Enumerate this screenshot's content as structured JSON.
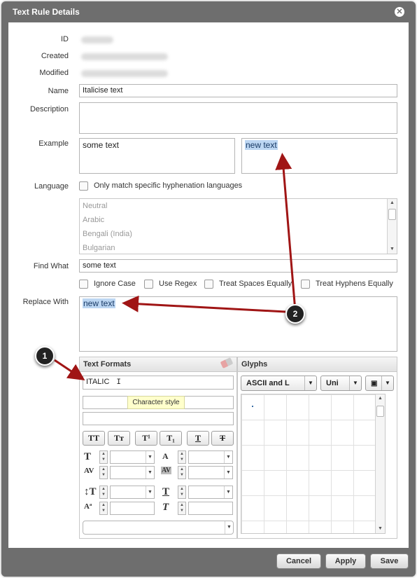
{
  "dialog": {
    "title": "Text Rule Details"
  },
  "fields": {
    "id_label": "ID",
    "created_label": "Created",
    "modified_label": "Modified",
    "name_label": "Name",
    "name_value": "Italicise text",
    "description_label": "Description",
    "example_label": "Example",
    "example_find": "some text",
    "example_replace": "new text",
    "language_label": "Language",
    "language_checkbox": "Only match specific hyphenation languages",
    "languages": [
      "Neutral",
      "Arabic",
      "Bengali (India)",
      "Bulgarian"
    ],
    "find_label": "Find What",
    "find_value": "some text",
    "options": [
      "Ignore Case",
      "Use Regex",
      "Treat Spaces Equally",
      "Treat Hyphens Equally"
    ],
    "replace_label": "Replace With",
    "replace_value": "new text"
  },
  "text_formats": {
    "title": "Text Formats",
    "style_value": "ITALIC",
    "tooltip": "Character style",
    "buttons": [
      "TT",
      "Tт",
      "T¹",
      "T₁",
      "T",
      "T"
    ]
  },
  "glyphs": {
    "title": "Glyphs",
    "charset": "ASCII and L",
    "mode": "Uni"
  },
  "footer": {
    "cancel": "Cancel",
    "apply": "Apply",
    "save": "Save"
  },
  "annotations": [
    "1",
    "2"
  ],
  "colors": {
    "chrome": "#6e6e6e",
    "arrow": "#a01515",
    "selection": "#bcd6f2"
  }
}
